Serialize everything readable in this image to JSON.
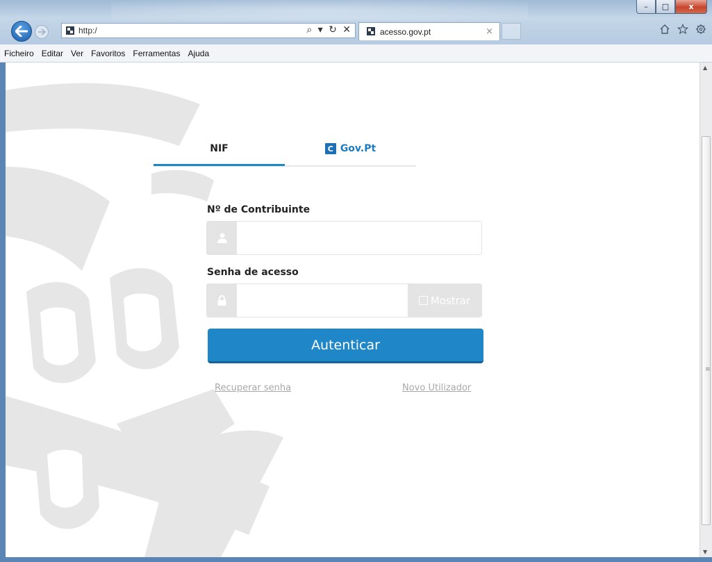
{
  "browser": {
    "address_url": "http:/",
    "address_controls": "⌕ ▾ ↻ ✕",
    "tab_title": "acesso.gov.pt",
    "tab_close": "×",
    "window_controls": {
      "minimize": "–",
      "maximize": "□",
      "close": "x"
    }
  },
  "menu": {
    "items": [
      "Ficheiro",
      "Editar",
      "Ver",
      "Favoritos",
      "Ferramentas",
      "Ajuda"
    ]
  },
  "login": {
    "tabs": {
      "nif": "NIF",
      "govpt": "Gov.Pt",
      "govpt_logo": "C"
    },
    "nif_label": "Nº de Contribuinte",
    "password_label": "Senha de acesso",
    "show_label": "Mostrar",
    "submit_label": "Autenticar",
    "recover_link": "Recuperar senha",
    "new_user_link": "Novo Utilizador"
  },
  "colors": {
    "accent": "#1f86c8",
    "govpt_text": "#1f7bbf",
    "addon_bg": "#e4e4e4",
    "link": "#a8a8a8"
  },
  "icons": {
    "back": "arrow-left-icon",
    "forward": "arrow-right-icon",
    "home": "home-icon",
    "favorites": "star-icon",
    "tools": "gear-icon",
    "user": "user-icon",
    "lock": "lock-icon"
  }
}
